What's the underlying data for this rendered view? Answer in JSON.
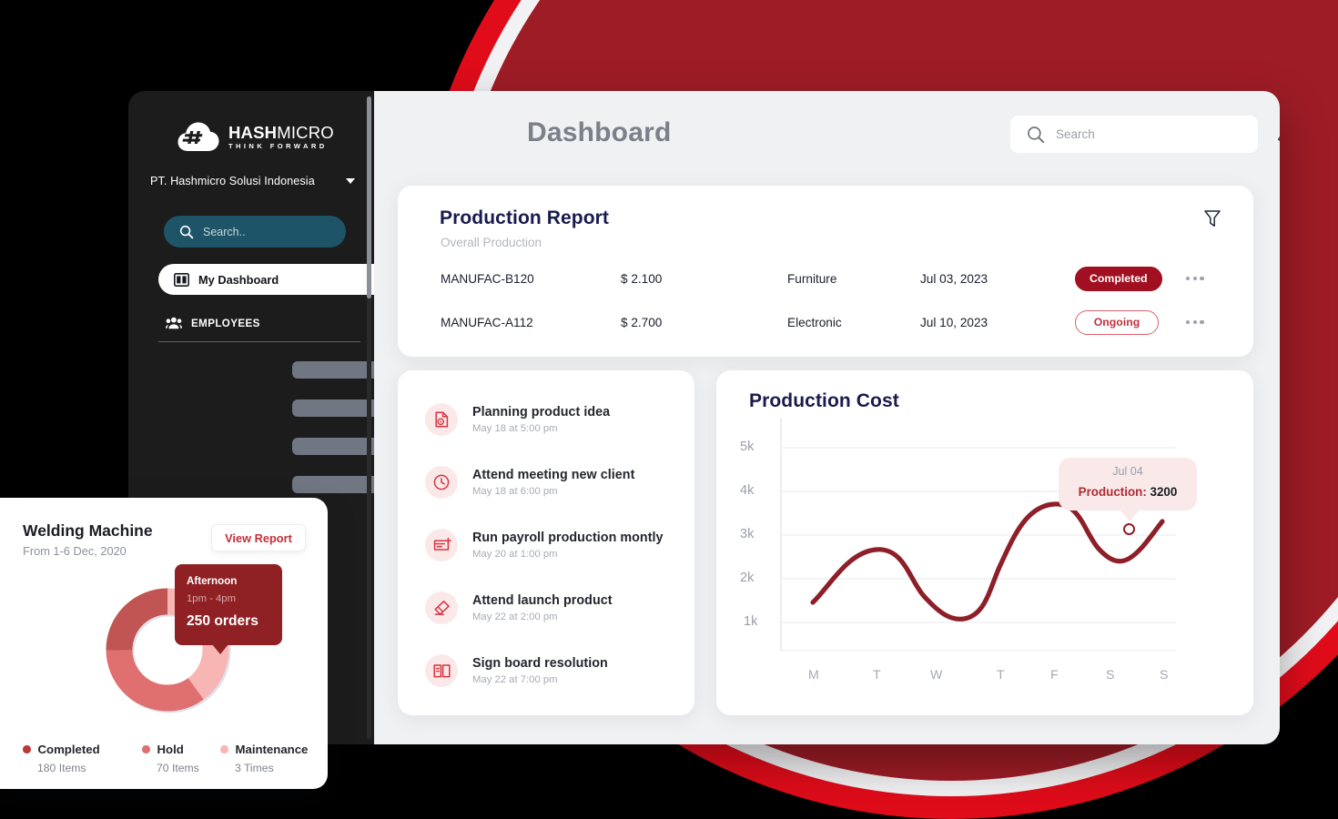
{
  "colors": {
    "brand_red": "#a01020",
    "deco_red_outer": "#e00c1a",
    "deco_red_inner": "#9e1c26",
    "sidebar_bg": "#1c1c1c",
    "sidebar_search": "#1d5467",
    "main_bg": "#f0f1f3",
    "title_navy": "#191b4d",
    "line_dark_red": "#8e1f28",
    "donut_completed": "#b83a3a",
    "donut_hold": "#e0706f",
    "donut_maintenance": "#f7b6b4"
  },
  "sidebar": {
    "logo": {
      "name": "HASH",
      "name_thin": "MICRO",
      "tagline": "THINK FORWARD",
      "icon": "hashmicro-cloud-logo"
    },
    "company": {
      "name": "PT. Hashmicro Solusi Indonesia",
      "caret": "chevron-down-icon"
    },
    "search": {
      "placeholder": "Search..",
      "icon": "search-icon"
    },
    "active_item": {
      "label": "My Dashboard",
      "icon": "dashboard-icon"
    },
    "section": {
      "label": "EMPLOYEES",
      "icon": "people-icon"
    },
    "skeleton_widths": [
      95,
      95,
      95,
      140
    ]
  },
  "header": {
    "title": "Dashboard",
    "search": {
      "placeholder": "Search",
      "icon": "search-icon"
    },
    "bell_icon": "bell-icon",
    "profile": {
      "avatar": "user-avatar",
      "caret": "chevron-down-icon"
    }
  },
  "production_report": {
    "title": "Production Report",
    "subtitle": "Overall Production",
    "filter_icon": "filter-icon",
    "rows": [
      {
        "code": "MANUFAC-B120",
        "price": "$ 2.100",
        "category": "Furniture",
        "date": "Jul 03, 2023",
        "status": "Completed",
        "status_kind": "completed",
        "menu_icon": "more-options-icon"
      },
      {
        "code": "MANUFAC-A112",
        "price": "$ 2.700",
        "category": "Electronic",
        "date": "Jul 10, 2023",
        "status": "Ongoing",
        "status_kind": "ongoing",
        "menu_icon": "more-options-icon"
      }
    ]
  },
  "tasks": [
    {
      "title": "Planning product idea",
      "time": "May 18 at 5:00 pm",
      "icon": "file-heart-icon"
    },
    {
      "title": "Attend meeting new client",
      "time": "May 18 at 6:00 pm",
      "icon": "clock-icon"
    },
    {
      "title": "Run payroll production montly",
      "time": "May 20 at 1:00 pm",
      "icon": "card-plus-icon"
    },
    {
      "title": "Attend launch product",
      "time": "May 22 at 2:00 pm",
      "icon": "eraser-icon"
    },
    {
      "title": "Sign board resolution",
      "time": "May 22 at 7:00 pm",
      "icon": "book-icon"
    }
  ],
  "production_cost": {
    "title": "Production Cost",
    "tooltip": {
      "date": "Jul 04",
      "label": "Production:",
      "value": "3200"
    }
  },
  "welding": {
    "title": "Welding Machine",
    "subtitle": "From 1-6 Dec, 2020",
    "button": "View Report",
    "tooltip": {
      "period": "Afternoon",
      "hours": "1pm - 4pm",
      "orders": "250 orders"
    },
    "legend": [
      {
        "name": "Completed",
        "value": "180 Items",
        "color": "#b83a3a"
      },
      {
        "name": "Hold",
        "value": "70 Items",
        "color": "#e0706f"
      },
      {
        "name": "Maintenance",
        "value": "3 Times",
        "color": "#f7b6b4"
      }
    ]
  },
  "chart_data": [
    {
      "type": "line",
      "title": "Production Cost",
      "x": [
        "M",
        "T",
        "W",
        "T",
        "F",
        "S",
        "S"
      ],
      "categories": [
        "M",
        "T",
        "W",
        "T",
        "F",
        "S",
        "S"
      ],
      "values": [
        1400,
        2750,
        1750,
        2050,
        3800,
        3000,
        3700
      ],
      "series": [
        {
          "name": "Production",
          "values": [
            1400,
            2750,
            1750,
            2050,
            3800,
            3000,
            3700
          ]
        }
      ],
      "xlabel": "",
      "ylabel": "",
      "ylim": [
        0,
        5500
      ],
      "yticks": [
        1000,
        2000,
        3000,
        4000,
        5000
      ],
      "ytick_labels": [
        "1k",
        "2k",
        "3k",
        "4k",
        "5k"
      ],
      "grid": true,
      "legend": "none",
      "annotations": [
        {
          "label": "Jul 04",
          "text": "Production: 3200",
          "value": 3200
        }
      ]
    },
    {
      "type": "pie",
      "title": "Welding Machine",
      "categories": [
        "Completed",
        "Hold",
        "Maintenance"
      ],
      "values": [
        180,
        70,
        3
      ],
      "value_labels": [
        "180 Items",
        "70 Items",
        "3 Times"
      ],
      "colors": [
        "#b83a3a",
        "#e0706f",
        "#f7b6b4"
      ],
      "donut": true,
      "legend": "bottom",
      "annotations": [
        {
          "label": "Afternoon",
          "sublabel": "1pm - 4pm",
          "text": "250 orders"
        }
      ]
    }
  ]
}
